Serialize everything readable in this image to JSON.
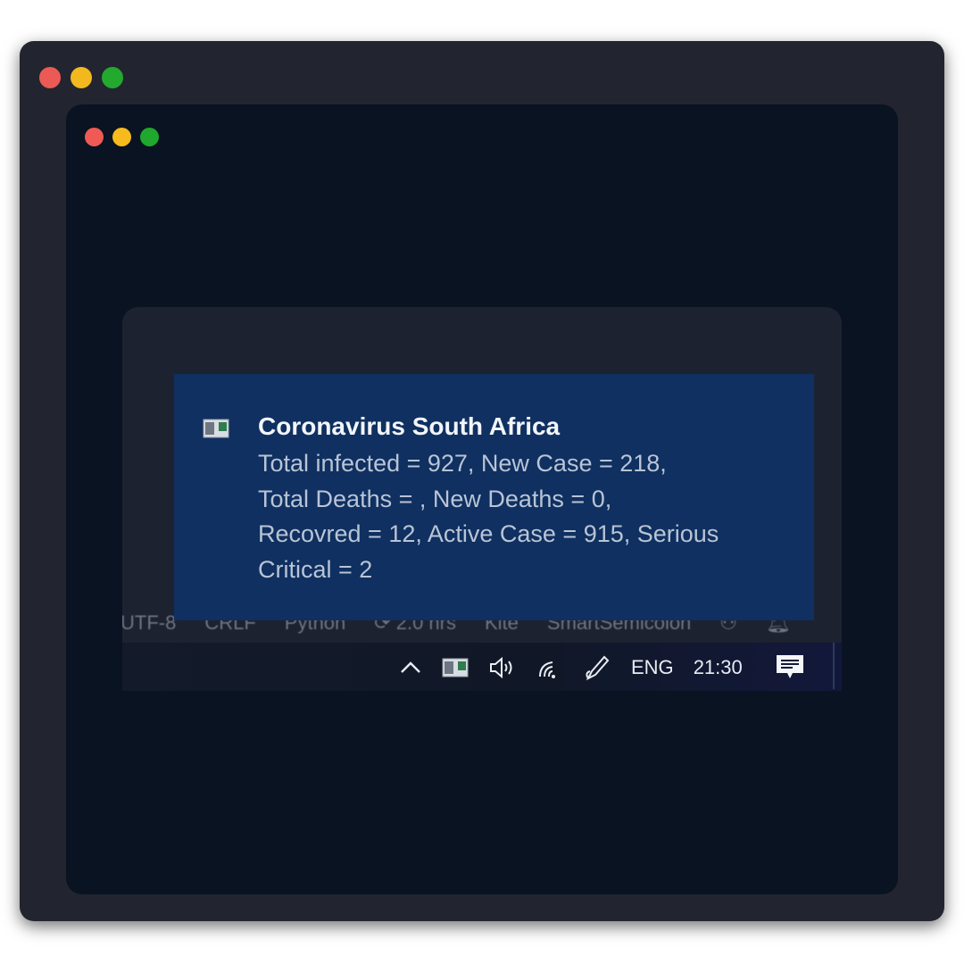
{
  "window": {
    "outer_dots": [
      "#ec5a55",
      "#f4b81f",
      "#23a92e"
    ],
    "inner_dots": [
      "#ef5a55",
      "#f7bb1d",
      "#1fa72e"
    ]
  },
  "status_bar": {
    "items": [
      "UTF-8",
      "CRLF",
      "Python",
      "2.0 hrs",
      "Kite",
      "SmartSemicolon"
    ]
  },
  "notification": {
    "app_icon": "app-window-icon",
    "title": "Coronavirus South Africa",
    "lines": [
      "Total infected = 927, New Case = 218,",
      "Total Deaths = , New Deaths = 0,",
      "Recovred = 12, Active Case = 915, Serious",
      "Critical = 2"
    ]
  },
  "tray": {
    "icons": [
      "chevron-up-icon",
      "app-window-icon",
      "speaker-icon",
      "wifi-icon",
      "pen-icon",
      "action-center-icon"
    ],
    "language": "ENG",
    "time": "21:30"
  },
  "colors": {
    "toast_bg": "#0f3060",
    "inner_bg": "#0a1321",
    "frame_bg": "#22252f"
  }
}
